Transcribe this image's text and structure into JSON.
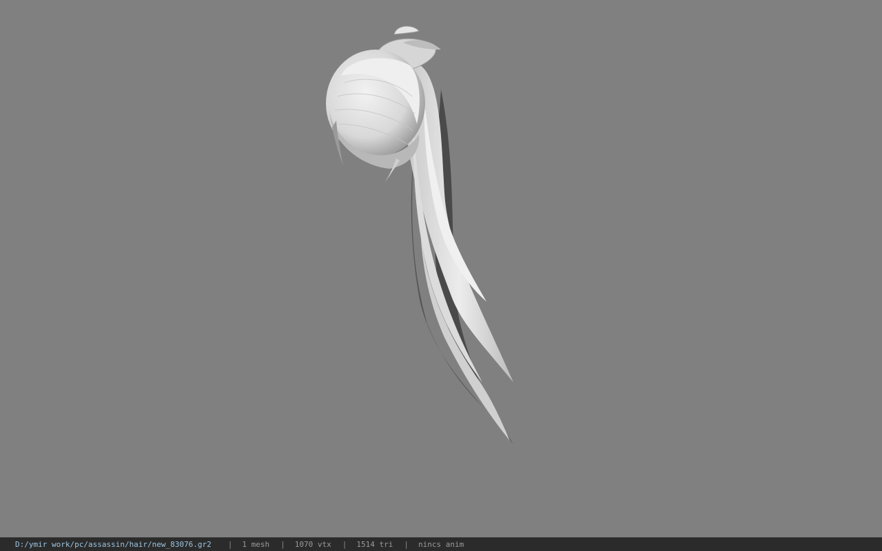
{
  "viewport": {
    "background_color": "#808080",
    "model_color": "#e8e8e8"
  },
  "statusbar": {
    "file_path": "D:/ymir work/pc/assassin/hair/new_83076.gr2",
    "separator": "|",
    "mesh_count": "1 mesh",
    "vertex_count": "1070 vtx",
    "triangle_count": "1514 tri",
    "anim_status": "nincs anim",
    "path_color": "#9cc4e0"
  }
}
